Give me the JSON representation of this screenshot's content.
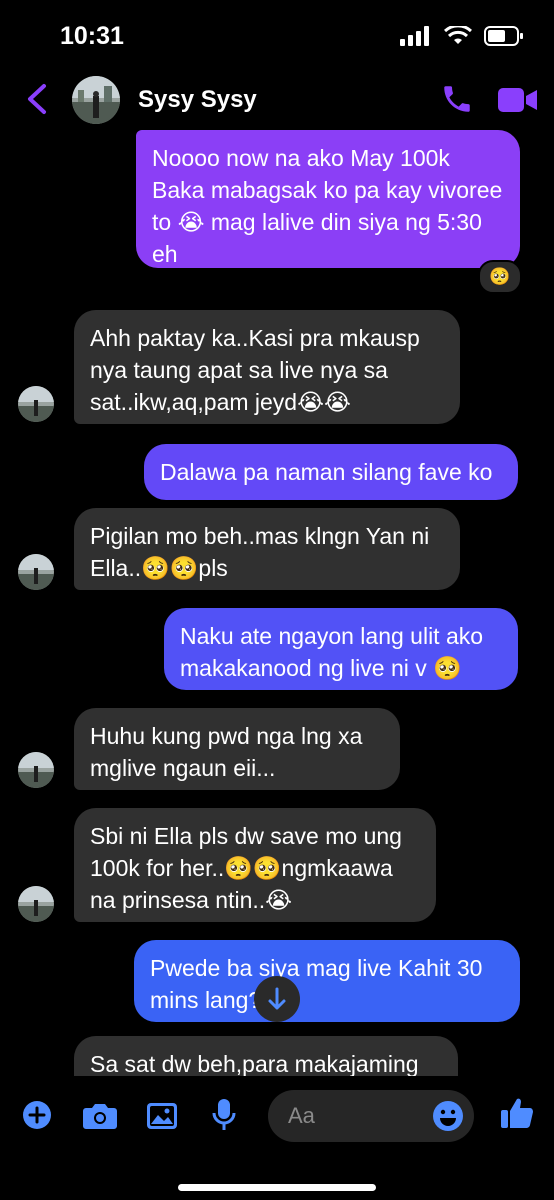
{
  "status": {
    "time": "10:31"
  },
  "header": {
    "contact_name": "Sysy Sysy"
  },
  "messages": [
    {
      "text": "Noooo now na ako May 100k Baka mabagsak ko pa kay vivoree to 😭 mag lalive din siya ng 5:30 eh",
      "reaction": "🥺"
    },
    {
      "text": "Ahh paktay ka..Kasi pra mkausp nya taung apat sa live nya sa sat..ikw,aq,pam jeyd😭😭"
    },
    {
      "text": "Dalawa pa naman silang fave ko"
    },
    {
      "text": "Pigilan mo beh..mas klngn Yan ni Ella..🥺🥺pls"
    },
    {
      "text": "Naku ate ngayon lang ulit ako makakanood ng live ni v 🥺"
    },
    {
      "text": "Huhu kung pwd nga lng xa mglive ngaun eii..."
    },
    {
      "text": "Sbi ni Ella pls dw save mo ung 100k for her..🥺🥺ngmkaawa na prinsesa ntin..😭"
    },
    {
      "text": "Pwede ba siya mag live Kahit 30 mins lang?"
    },
    {
      "text": "Sa sat dw beh,para makajaming"
    }
  ],
  "composer": {
    "placeholder": "Aa"
  },
  "colors": {
    "accent": "#8a3ffc",
    "bubble_in": "#303030",
    "out_top": "#8b3ff6",
    "out_bottom": "#3a63f5"
  },
  "icons": [
    "back-icon",
    "phone-icon",
    "video-icon",
    "plus-icon",
    "camera-icon",
    "image-icon",
    "mic-icon",
    "emoji-icon",
    "like-icon",
    "arrow-down-icon",
    "signal-icon",
    "wifi-icon",
    "battery-icon"
  ]
}
